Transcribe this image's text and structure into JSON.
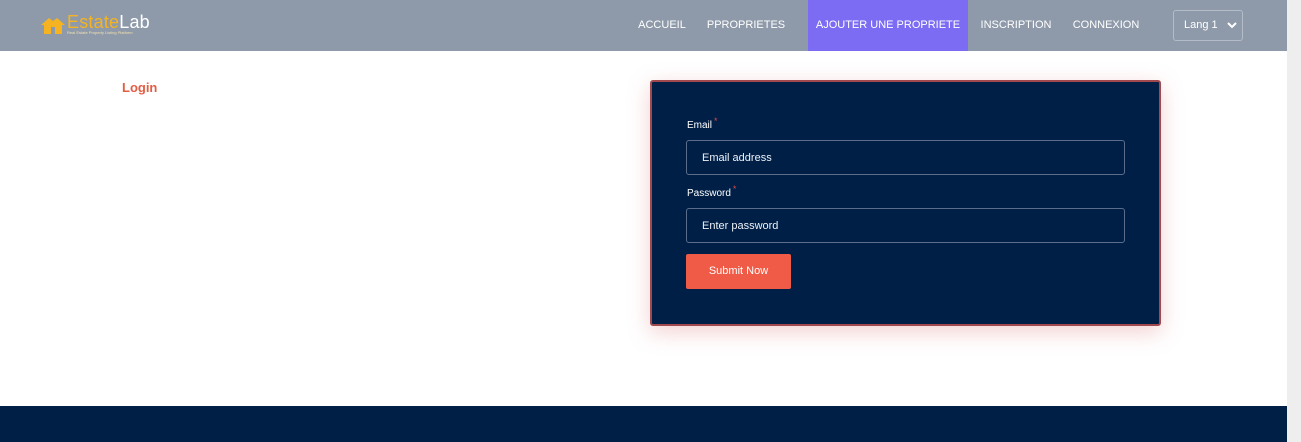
{
  "navbar": {
    "logo": {
      "brand_first": "Estate",
      "brand_second": "Lab",
      "tagline": "Real Estate Property Listing Platform",
      "icon": "house-icon"
    },
    "links": [
      {
        "label": "ACCUEIL",
        "active": false
      },
      {
        "label": "PPROPRIETES",
        "active": false
      },
      {
        "label": "AJOUTER UNE PROPRIETE",
        "active": true
      },
      {
        "label": "INSCRIPTION",
        "active": false
      },
      {
        "label": "CONNEXION",
        "active": false
      }
    ],
    "language": {
      "selected": "Lang 1",
      "icon": "chevron-down-icon"
    }
  },
  "page": {
    "heading": "Login"
  },
  "login_form": {
    "email": {
      "label": "Email",
      "required_mark": "*",
      "placeholder": "Email address",
      "value": ""
    },
    "password": {
      "label": "Password",
      "required_mark": "*",
      "placeholder": "Enter password",
      "value": ""
    },
    "submit_label": "Submit Now"
  },
  "colors": {
    "navbar_bg": "#8e9aaa",
    "active_nav_bg": "#7b6cf3",
    "navy": "#001f47",
    "accent": "#ef5b46",
    "heading_red": "#e35d44",
    "brand_yellow": "#f5b321"
  }
}
